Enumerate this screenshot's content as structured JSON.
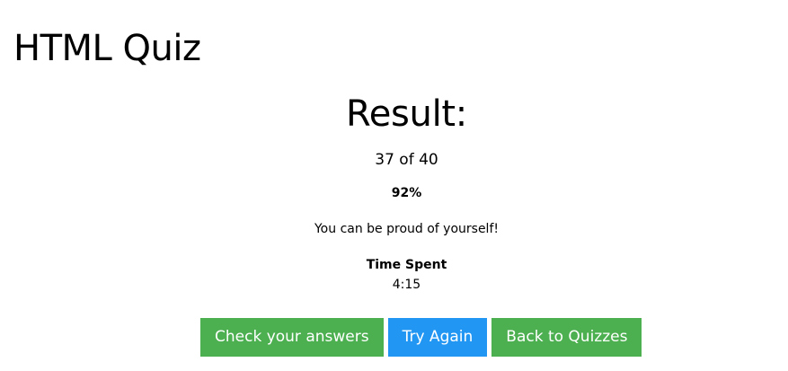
{
  "quiz": {
    "title": "HTML Quiz"
  },
  "result": {
    "heading": "Result:",
    "score": "37 of 40",
    "percent": "92%",
    "message": "You can be proud of yourself!",
    "time_label": "Time Spent",
    "time_value": "4:15"
  },
  "buttons": {
    "check_answers": {
      "label": "Check your answers",
      "color": "#4caf50"
    },
    "try_again": {
      "label": "Try Again",
      "color": "#2196f3"
    },
    "back_to_quizzes": {
      "label": "Back to Quizzes",
      "color": "#4caf50"
    }
  }
}
